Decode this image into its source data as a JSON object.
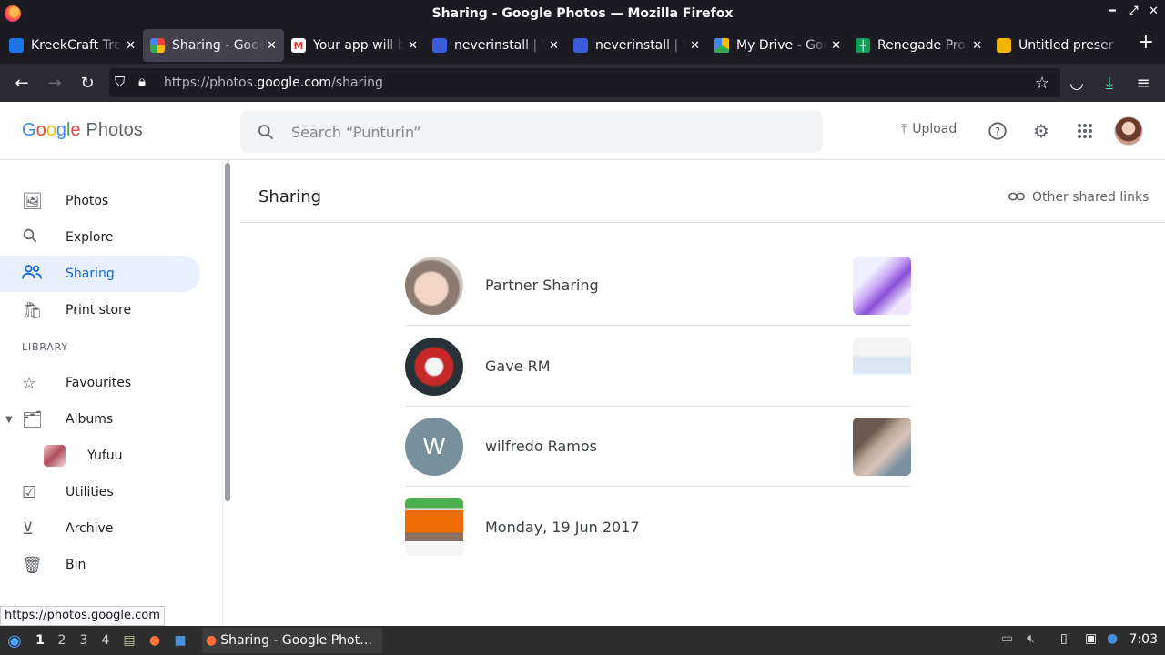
{
  "window": {
    "title": "Sharing - Google Photos — Mozilla Firefox"
  },
  "tabs": [
    {
      "label": "KreekCraft Tre",
      "color": "#1a73e8"
    },
    {
      "label": "Sharing - Goog",
      "color": "#fbbc05",
      "active": true
    },
    {
      "label": "Your app will b",
      "color": "#ea4335"
    },
    {
      "label": "neverinstall | Y",
      "color": "#3b5bdb"
    },
    {
      "label": "neverinstall | Y",
      "color": "#3b5bdb"
    },
    {
      "label": "My Drive - Goo",
      "color": "#34a853"
    },
    {
      "label": "Renegade Proj",
      "color": "#0f9d58"
    },
    {
      "label": "Untitled preser",
      "color": "#f4b400"
    }
  ],
  "nav": {
    "url_prefix": "https://photos.",
    "url_domain": "google.com",
    "url_path": "/sharing"
  },
  "header": {
    "logo_product": "Photos",
    "search_placeholder": "Search “Punturin”",
    "upload_label": "Upload"
  },
  "sidebar": {
    "items": [
      {
        "label": "Photos"
      },
      {
        "label": "Explore"
      },
      {
        "label": "Sharing"
      },
      {
        "label": "Print store"
      }
    ],
    "library_label": "LIBRARY",
    "library_items": [
      {
        "label": "Favourites"
      },
      {
        "label": "Albums"
      },
      {
        "label": "Yufuu"
      },
      {
        "label": "Utilities"
      },
      {
        "label": "Archive"
      },
      {
        "label": "Bin"
      }
    ]
  },
  "main": {
    "title": "Sharing",
    "other_links": "Other shared links",
    "shares": [
      {
        "name": "Partner Sharing"
      },
      {
        "name": "Gave RM"
      },
      {
        "name": "wilfredo Ramos",
        "initial": "W"
      },
      {
        "name": "Monday, 19 Jun 2017"
      }
    ]
  },
  "status": {
    "hover_url": "https://photos.google.com"
  },
  "taskbar": {
    "workspaces": [
      "1",
      "2",
      "3",
      "4"
    ],
    "window_label": "Sharing - Google Phot…",
    "clock": "7:03"
  }
}
